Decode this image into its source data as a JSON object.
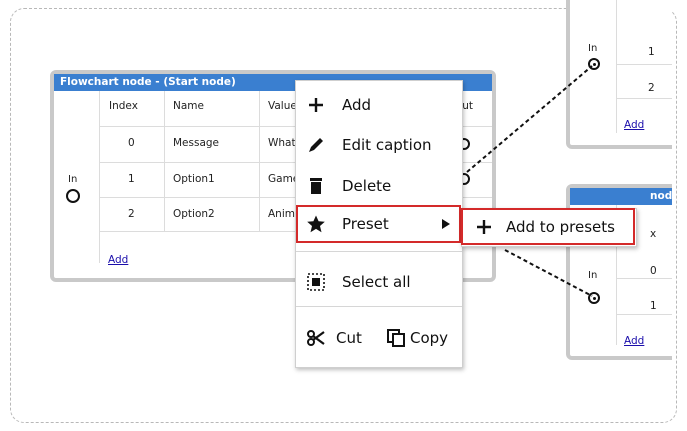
{
  "start_node": {
    "title": "Flowchart node - (Start node)",
    "columns": [
      "Index",
      "Name",
      "Value",
      "Out"
    ],
    "rows": [
      {
        "index": "0",
        "name": "Message",
        "value": "What"
      },
      {
        "index": "1",
        "name": "Option1",
        "value": "Game"
      },
      {
        "index": "2",
        "name": "Option2",
        "value": "Anim"
      }
    ],
    "in_label": "In",
    "add_link": "Add"
  },
  "right_node_top": {
    "in_label": "In",
    "rows": [
      {
        "index": "1"
      },
      {
        "index": "2"
      }
    ],
    "add_link": "Add"
  },
  "right_node_bottom": {
    "title": "node",
    "column_header": "x",
    "in_label": "In",
    "rows": [
      {
        "index": "0"
      },
      {
        "index": "1"
      }
    ],
    "add_link": "Add"
  },
  "context_menu": {
    "items": [
      {
        "label": "Add",
        "icon": "plus-icon"
      },
      {
        "label": "Edit caption",
        "icon": "pencil-icon"
      },
      {
        "label": "Delete",
        "icon": "trash-icon"
      },
      {
        "label": "Preset",
        "icon": "star-icon",
        "has_submenu": true
      },
      {
        "label": "Select all",
        "icon": "select-all-icon"
      }
    ],
    "cut_label": "Cut",
    "copy_label": "Copy"
  },
  "submenu": {
    "items": [
      {
        "label": "Add to presets",
        "icon": "plus-icon"
      }
    ]
  },
  "colors": {
    "title_bar": "#3a7fd0",
    "highlight": "#d42a2a",
    "node_border": "#c9c9c9",
    "link": "#1a0dab"
  }
}
